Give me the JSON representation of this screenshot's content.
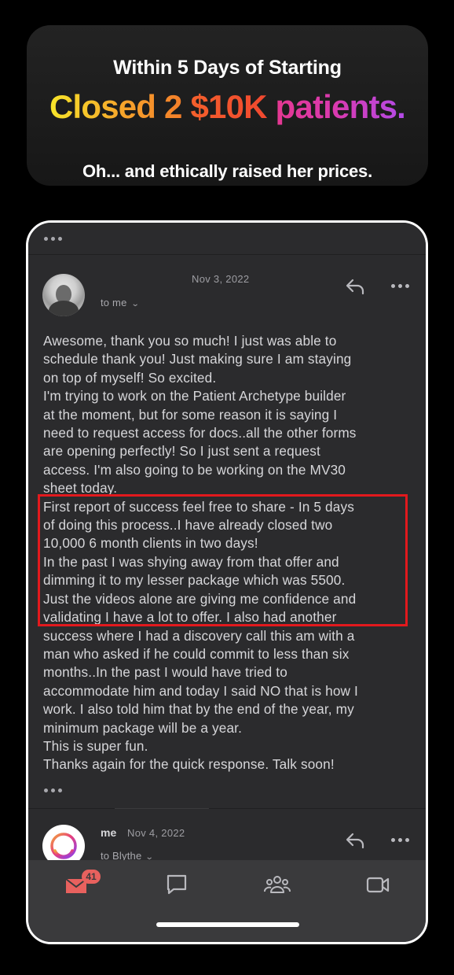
{
  "banner": {
    "line1": "Within 5 Days of Starting",
    "line2_part1": "Closed 2 ",
    "line2_part2": "$10K",
    "line2_part3": " patients.",
    "line3": "Oh... and ethically raised her prices."
  },
  "email1": {
    "date": "Nov 3, 2022",
    "recipient": "to me",
    "body": "Awesome, thank you so much! I just was able to\nschedule thank you! Just making sure I am staying\non top of myself! So excited.\nI'm trying to work on the Patient Archetype builder\nat the moment, but for some reason it is saying I\nneed to request access for docs..all the other forms\nare opening perfectly! So I just sent a request\naccess. I'm also going to be working on the MV30\nsheet today.\nFirst report of success feel free to share - In 5 days\nof doing this process..I have already closed two\n10,000 6 month clients in two days!\nIn the past I was shying away from that offer and\ndimming it to my lesser package which was 5500.\nJust the videos alone are giving me confidence and\nvalidating I have a lot to offer. I also had another\nsuccess where I had a discovery call this am with a\nman who asked if he could commit to less than six\nmonths..In the past I would have tried to\naccommodate him and today I said NO that is how I\nwork. I also told him that by the end of the year, my\nminimum package will be a year.\nThis is super fun.\nThanks again for the quick response. Talk soon!"
  },
  "email2": {
    "sender": "me",
    "date": "Nov 4, 2022",
    "recipient": "to Blythe"
  },
  "tabbar": {
    "mail_badge": "41"
  },
  "colors": {
    "highlight_border": "#e2191d",
    "badge": "#e8615e",
    "background": "#000000",
    "email_bg": "#2b2b2d"
  }
}
